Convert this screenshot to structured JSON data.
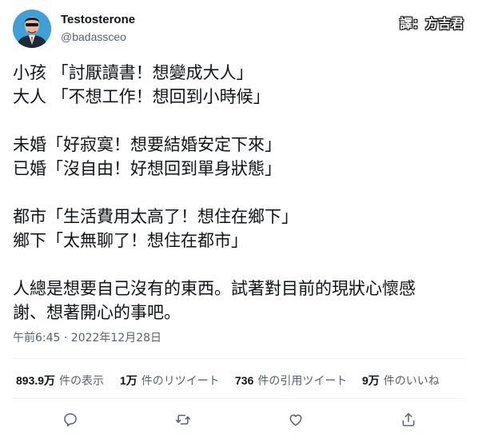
{
  "author": {
    "name": "Testosterone",
    "handle": "@badassceo",
    "avatar_icon": "avatar-businessman-icon"
  },
  "translator_badge": "譯：方吉君",
  "tweet": {
    "lines": [
      "小孩 「討厭讀書！想變成大人」",
      "大人 「不想工作！想回到小時候」",
      "",
      "未婚「好寂寞！想要結婚安定下來」",
      "已婚「沒自由！好想回到單身狀態」",
      "",
      "都市「生活費用太高了！想住在鄉下」",
      "鄉下「太無聊了！想住在都市」",
      "",
      "人總是想要自己沒有的東西。試著對目前的現狀心懷感",
      "謝、想著開心的事吧。"
    ]
  },
  "timestamp": "午前6:45 · 2022年12月28日",
  "stats": {
    "views_count": "893.9万",
    "views_label": "件の表示",
    "retweets_count": "1万",
    "retweets_label": "件のリツイート",
    "quotes_count": "736",
    "quotes_label": "件の引用ツイート",
    "likes_count": "9万",
    "likes_label": "件のいいね"
  },
  "actions": [
    {
      "icon": "reply-icon"
    },
    {
      "icon": "retweet-icon"
    },
    {
      "icon": "like-icon"
    },
    {
      "icon": "share-icon"
    }
  ],
  "colors": {
    "text_primary": "#0f1419",
    "text_secondary": "#536471",
    "divider": "#eff3f4"
  }
}
